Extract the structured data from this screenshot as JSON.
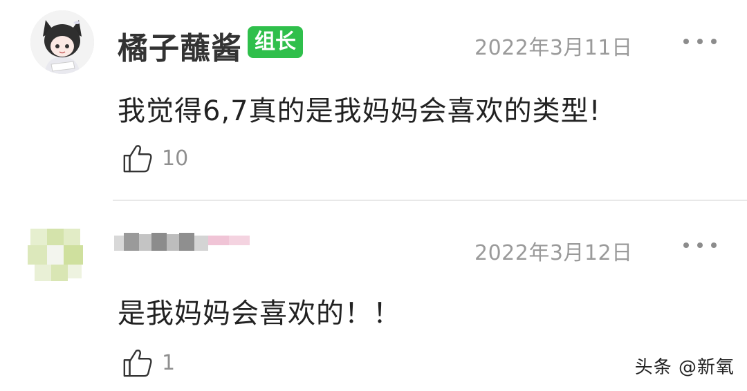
{
  "comments": [
    {
      "username": "橘子蘸酱",
      "badge": "组长",
      "timestamp": "2022年3月11日",
      "text": "我觉得6,7真的是我妈妈会喜欢的类型!",
      "likes": "10",
      "avatar_icon": "anime-cat-girl-avatar"
    },
    {
      "username_blurred": true,
      "timestamp": "2022年3月12日",
      "text": "是我妈妈会喜欢的！！",
      "likes": "1",
      "avatar_icon": "blurred-avatar"
    }
  ],
  "icons": {
    "like": "thumbs-up-icon",
    "more": "more-options-icon"
  },
  "colors": {
    "badge_bg": "#2fbf4b",
    "timestamp": "#9a9a9a",
    "divider": "#e8e8e8"
  },
  "watermark": "头条 @新氧"
}
